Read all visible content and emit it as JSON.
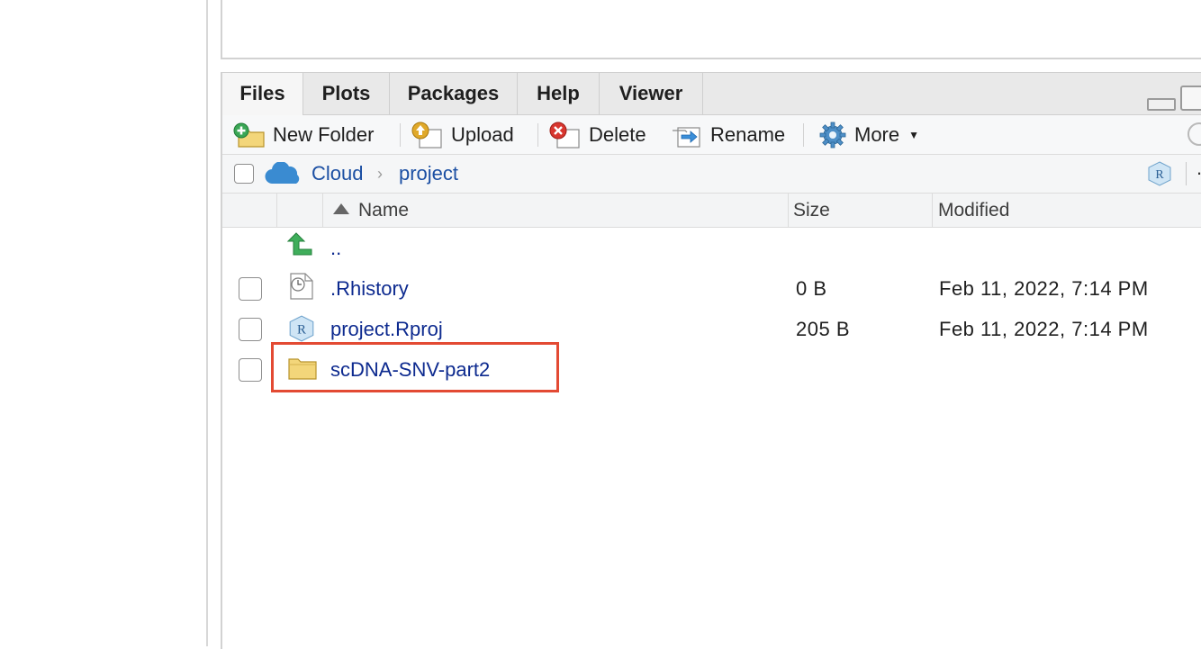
{
  "tabs": [
    {
      "label": "Files",
      "active": true
    },
    {
      "label": "Plots"
    },
    {
      "label": "Packages"
    },
    {
      "label": "Help"
    },
    {
      "label": "Viewer"
    }
  ],
  "toolbar": {
    "new_folder": "New Folder",
    "upload": "Upload",
    "delete": "Delete",
    "rename": "Rename",
    "more": "More"
  },
  "breadcrumb": {
    "root": "Cloud",
    "current": "project"
  },
  "columns": {
    "name": "Name",
    "size": "Size",
    "modified": "Modified"
  },
  "files": [
    {
      "name": "..",
      "type": "parent",
      "size": "",
      "modified": ""
    },
    {
      "name": ".Rhistory",
      "type": "history",
      "size": "0 B",
      "modified": "Feb 11, 2022, 7:14 PM"
    },
    {
      "name": "project.Rproj",
      "type": "rproj",
      "size": "205 B",
      "modified": "Feb 11, 2022, 7:14 PM"
    },
    {
      "name": "scDNA-SNV-part2",
      "type": "folder",
      "size": "",
      "modified": ""
    }
  ],
  "colors": {
    "link": "#0d2a8f",
    "highlight": "#e34a33",
    "tab_bg": "#e9e9e9"
  }
}
